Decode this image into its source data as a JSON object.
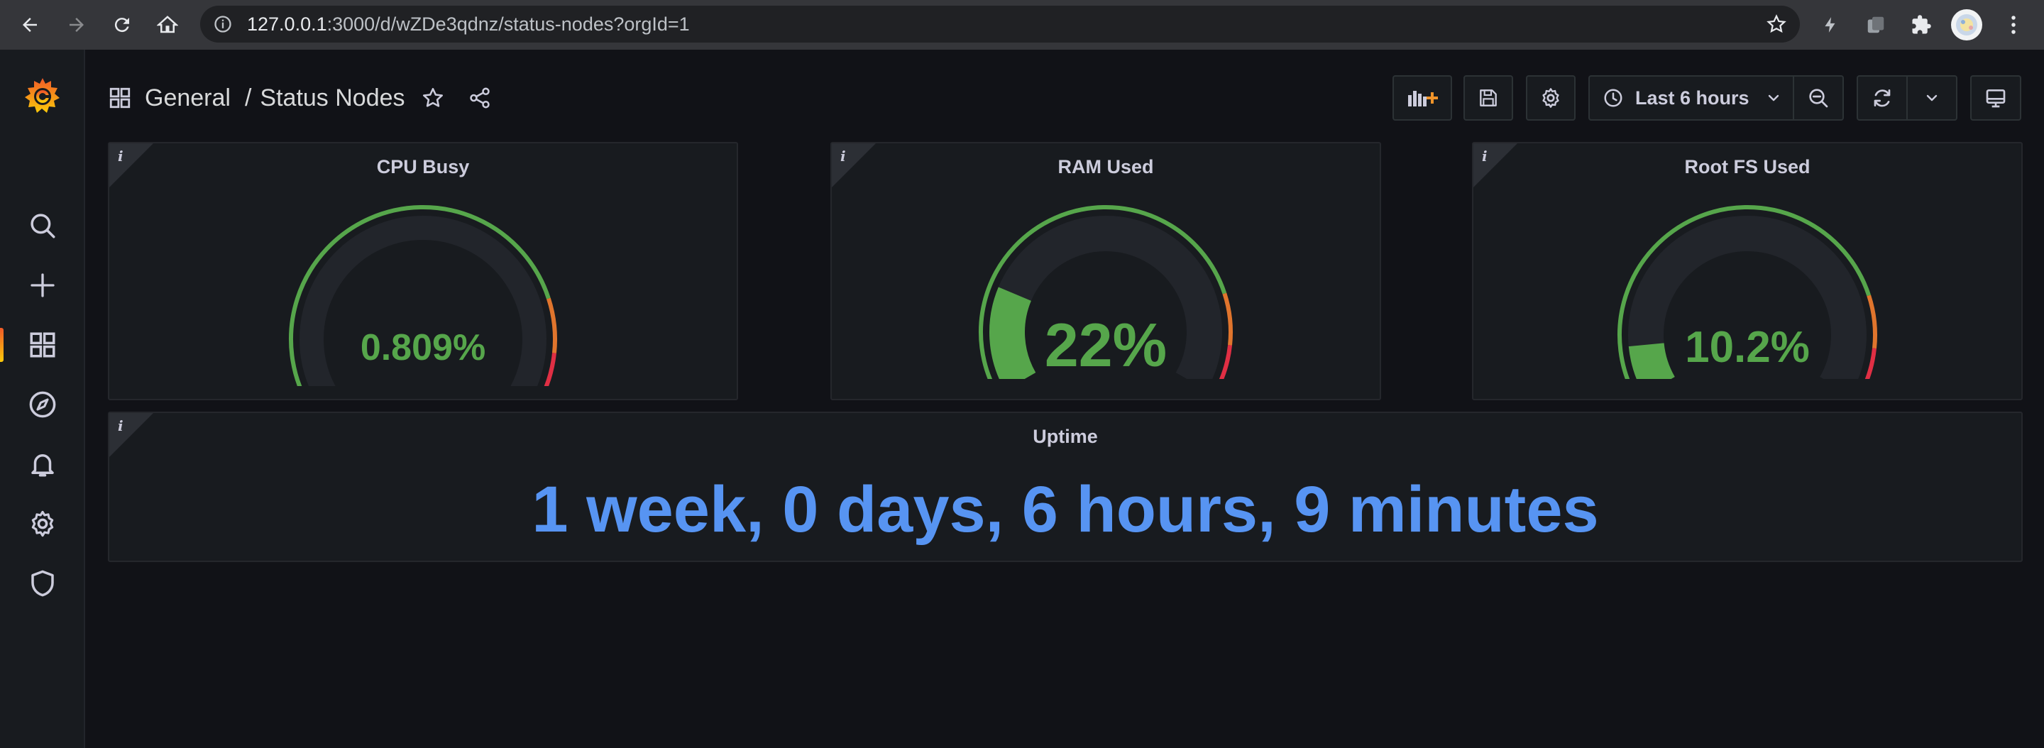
{
  "browser": {
    "url_host": "127.0.0.1",
    "url_rest": ":3000/d/wZDe3qdnz/status-nodes?orgId=1"
  },
  "dashboard": {
    "folder": "General",
    "separator": "/",
    "title": "Status Nodes",
    "time_range": "Last 6 hours"
  },
  "panels": {
    "cpu": {
      "title": "CPU Busy",
      "value": "0.809%",
      "level": 0.00809
    },
    "ram": {
      "title": "RAM Used",
      "value": "22%",
      "level": 0.22
    },
    "rootfs": {
      "title": "Root FS Used",
      "value": "10.2%",
      "level": 0.102
    },
    "uptime": {
      "title": "Uptime",
      "value": "1 week, 0 days, 6 hours, 9 minutes"
    }
  },
  "colors": {
    "ok": "#56a64b",
    "warn": "#e0752d",
    "critical": "#e02f44",
    "stat": "#5794f2",
    "track": "#22252b"
  }
}
